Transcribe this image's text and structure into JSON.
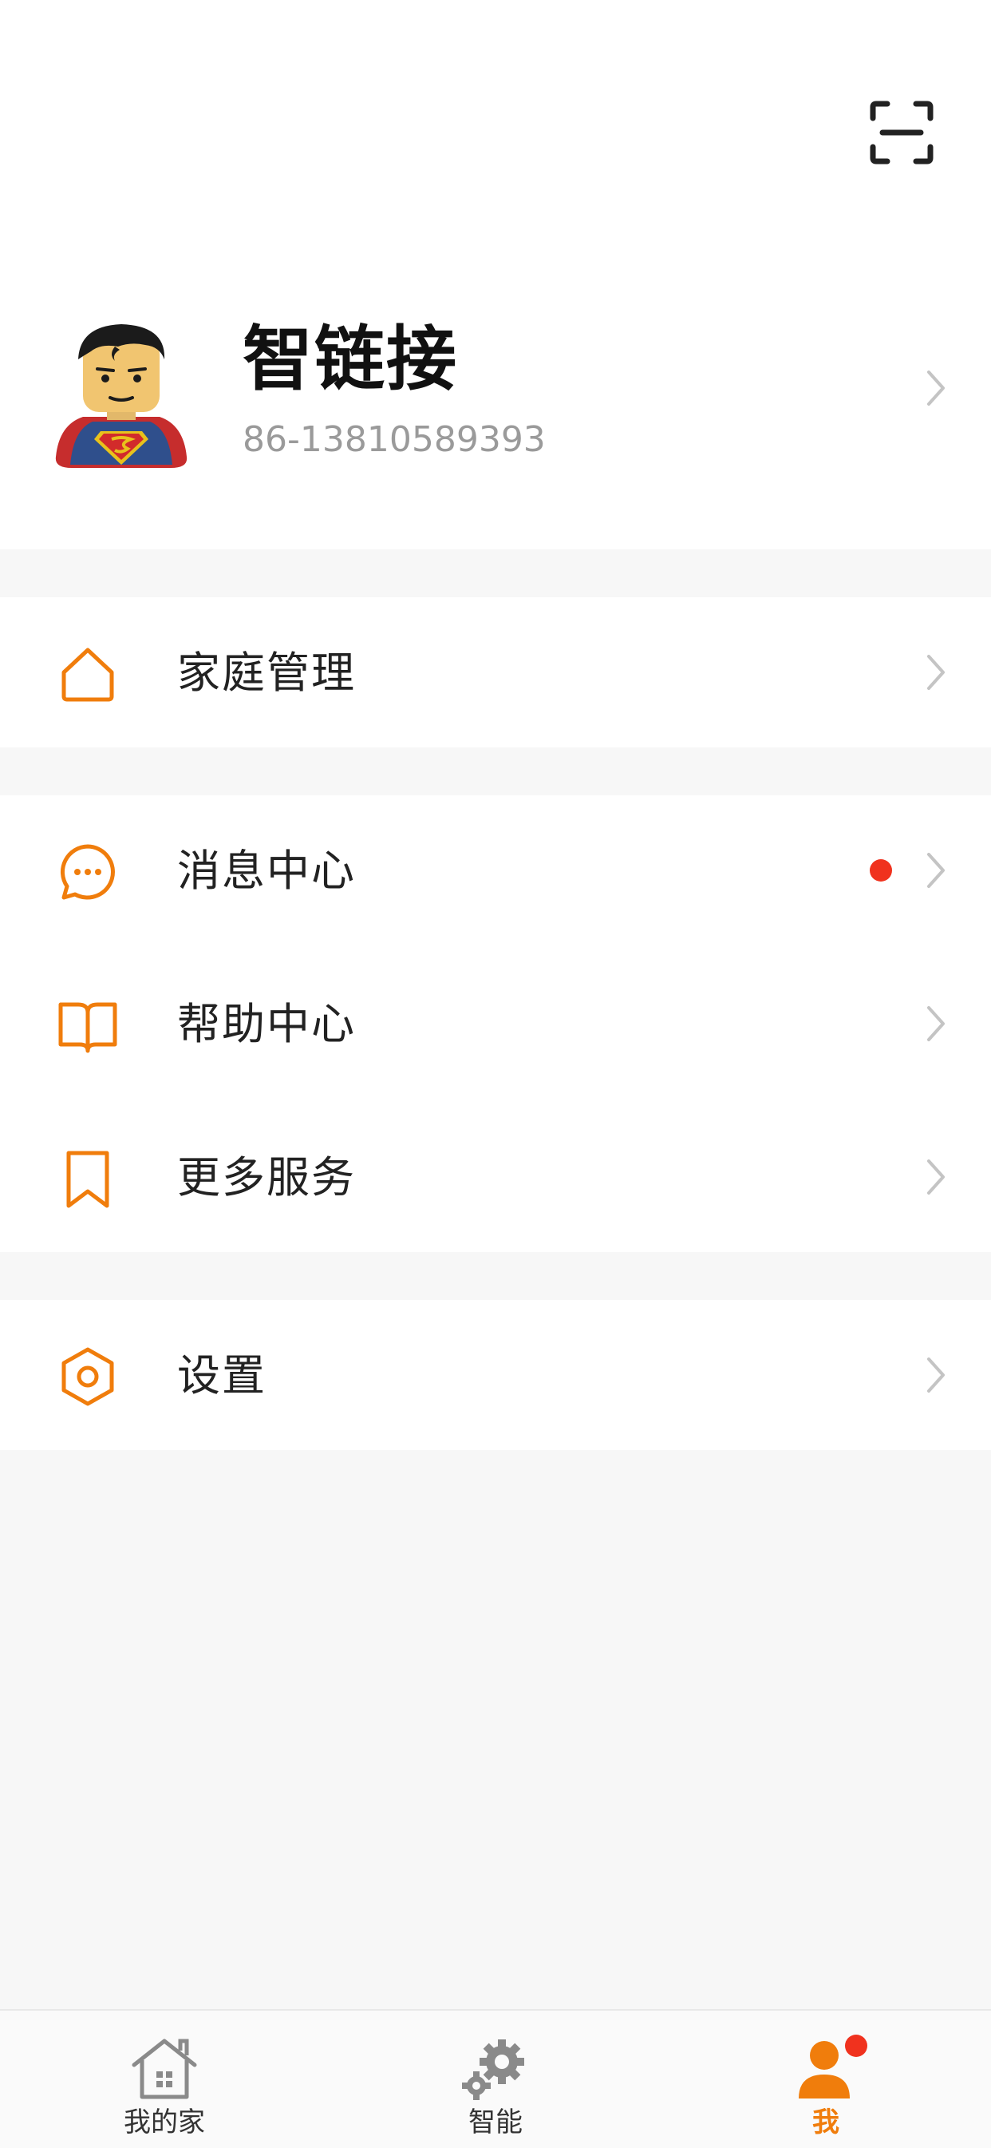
{
  "colors": {
    "accent": "#f07d0c",
    "badge": "#f0321e",
    "page_background": "#f7f7f7",
    "card_background": "#ffffff"
  },
  "header": {
    "scan_icon": "scan-icon"
  },
  "profile": {
    "name": "智链接",
    "phone": "86-13810589393",
    "avatar": "superman-lego-avatar"
  },
  "menu": {
    "family": {
      "label": "家庭管理",
      "icon": "home-icon"
    },
    "messages": {
      "label": "消息中心",
      "icon": "chat-bubble-icon",
      "unread": true
    },
    "help": {
      "label": "帮助中心",
      "icon": "book-icon"
    },
    "more": {
      "label": "更多服务",
      "icon": "bookmark-icon"
    },
    "settings": {
      "label": "设置",
      "icon": "hexagon-settings-icon"
    }
  },
  "tabbar": {
    "tabs": [
      {
        "label": "我的家",
        "icon": "house-icon",
        "active": false
      },
      {
        "label": "智能",
        "icon": "gears-icon",
        "active": false
      },
      {
        "label": "我",
        "icon": "person-icon",
        "active": true,
        "badge": true
      }
    ]
  }
}
